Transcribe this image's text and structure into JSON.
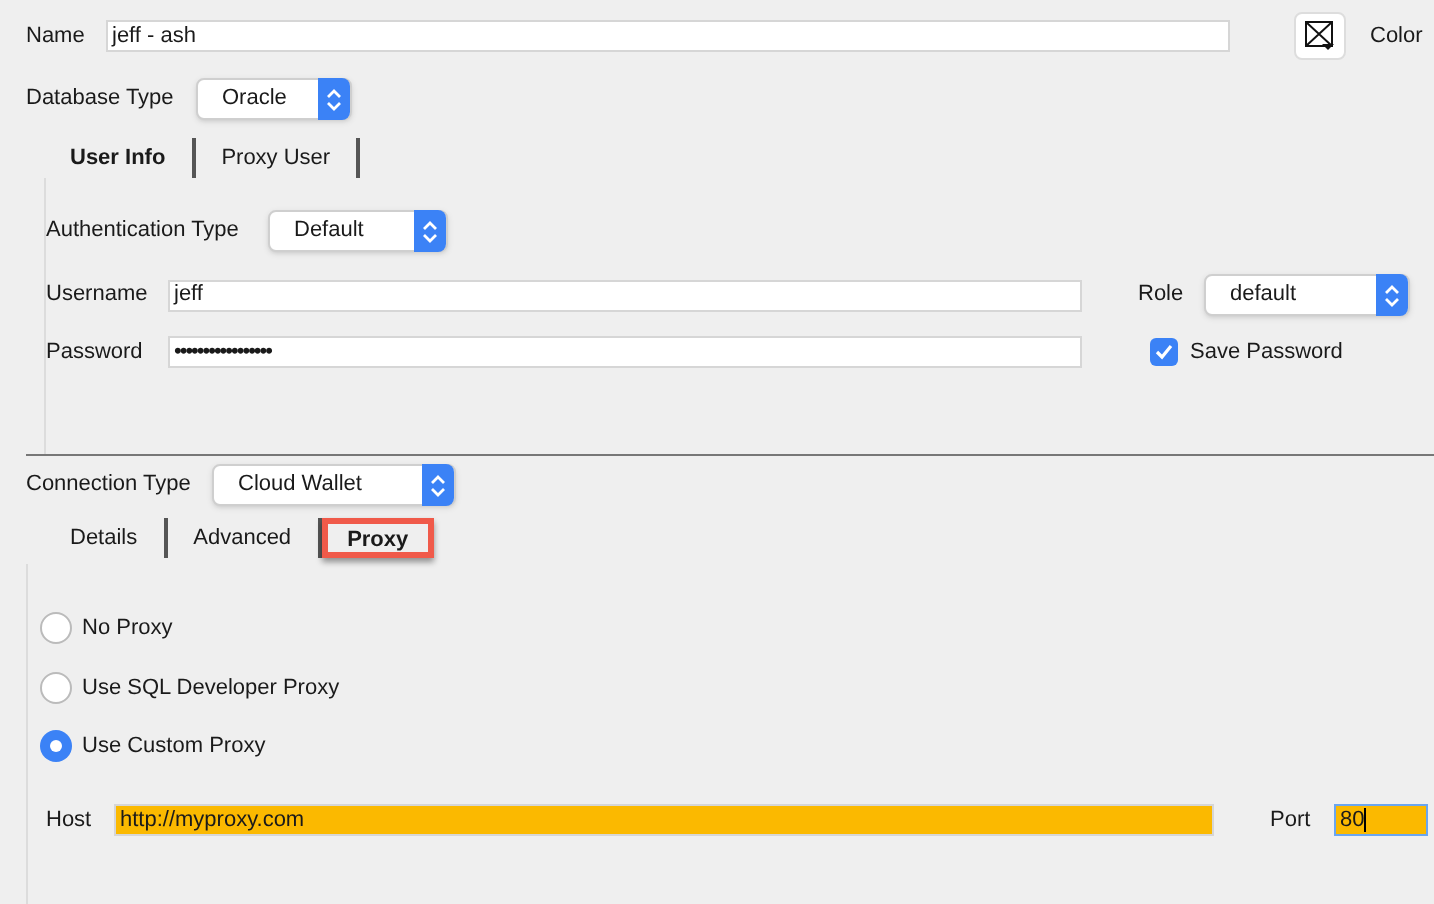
{
  "name": {
    "label": "Name",
    "value": "jeff - ash"
  },
  "color": {
    "label": "Color"
  },
  "database_type": {
    "label": "Database Type",
    "value": "Oracle"
  },
  "user_tabs": [
    {
      "label": "User Info",
      "selected": true
    },
    {
      "label": "Proxy User",
      "selected": false
    }
  ],
  "authentication_type": {
    "label": "Authentication Type",
    "value": "Default"
  },
  "username": {
    "label": "Username",
    "value": "jeff"
  },
  "role": {
    "label": "Role",
    "value": "default"
  },
  "password": {
    "label": "Password",
    "value": "•••••••••••••••••"
  },
  "save_password": {
    "label": "Save Password",
    "checked": true
  },
  "connection_type": {
    "label": "Connection Type",
    "value": "Cloud Wallet"
  },
  "connection_tabs": [
    {
      "label": "Details",
      "selected": false,
      "highlighted": false
    },
    {
      "label": "Advanced",
      "selected": false,
      "highlighted": false
    },
    {
      "label": "Proxy",
      "selected": true,
      "highlighted": true
    }
  ],
  "proxy_options": [
    {
      "label": "No Proxy",
      "selected": false
    },
    {
      "label": "Use SQL Developer Proxy",
      "selected": false
    },
    {
      "label": "Use Custom Proxy",
      "selected": true
    }
  ],
  "host": {
    "label": "Host",
    "value": "http://myproxy.com",
    "highlighted": true
  },
  "port": {
    "label": "Port",
    "value": "80",
    "highlighted": true,
    "focused": true
  }
}
